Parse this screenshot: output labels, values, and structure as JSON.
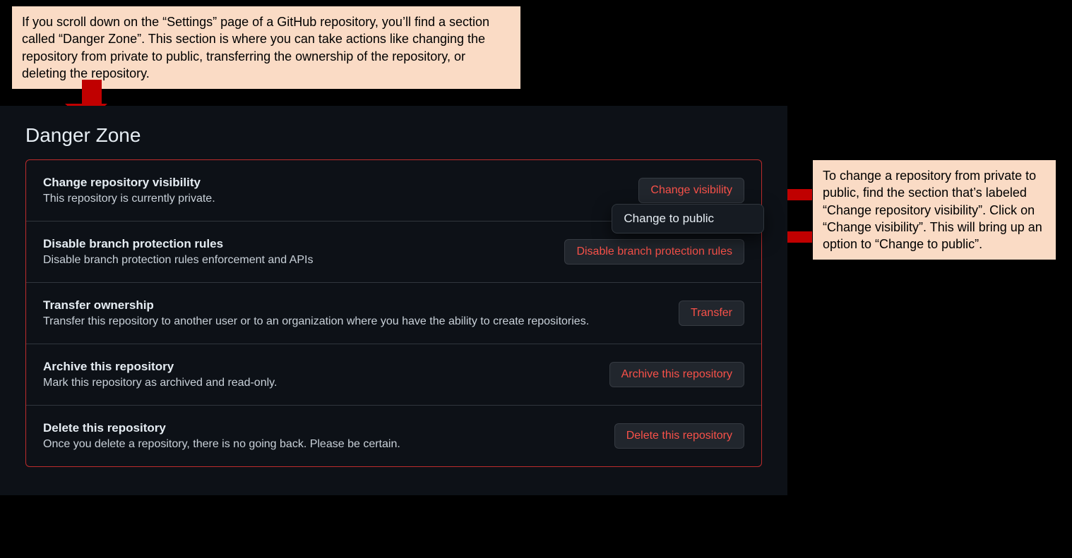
{
  "callouts": {
    "top": "If you scroll down on the “Settings” page of a GitHub repository, you’ll find a section called “Danger Zone”. This section is where you can take actions like changing the repository from private to public, transferring the ownership of the repository, or deleting the repository.",
    "right": "To change a repository from private to public, find the section that’s labeled “Change repository visibility”. Click on “Change visibility”. This will bring up an option to “Change to public”."
  },
  "section_title": "Danger Zone",
  "rows": {
    "visibility": {
      "title": "Change repository visibility",
      "desc": "This repository is currently private.",
      "button": "Change visibility",
      "dropdown_option": "Change to public"
    },
    "branch": {
      "title": "Disable branch protection rules",
      "desc": "Disable branch protection rules enforcement and APIs",
      "button": "Disable branch protection rules"
    },
    "transfer": {
      "title": "Transfer ownership",
      "desc": "Transfer this repository to another user or to an organization where you have the ability to create repositories.",
      "button": "Transfer"
    },
    "archive": {
      "title": "Archive this repository",
      "desc": "Mark this repository as archived and read-only.",
      "button": "Archive this repository"
    },
    "delete": {
      "title": "Delete this repository",
      "desc": "Once you delete a repository, there is no going back. Please be certain.",
      "button": "Delete this repository"
    }
  }
}
